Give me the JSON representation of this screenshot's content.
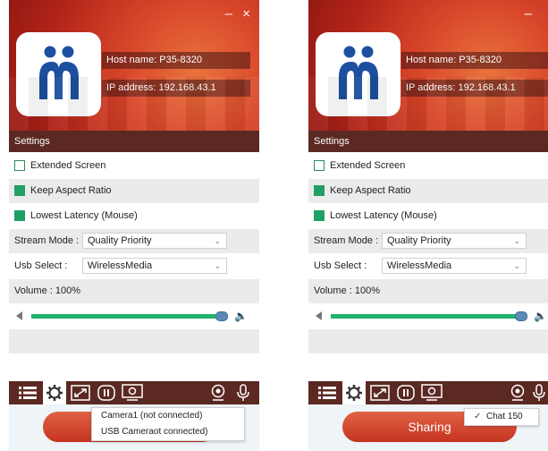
{
  "window": {
    "minimize_glyph": "–",
    "close_glyph": "×"
  },
  "panels": [
    {
      "host_name": "Host name: P35-8320",
      "ip_address": "IP address: 192.168.43.1",
      "settings_label": "Settings",
      "options": {
        "extended_screen": "Extended Screen",
        "extended_screen_checked": false,
        "keep_aspect": "Keep Aspect Ratio",
        "keep_aspect_checked": true,
        "lowest_latency": "Lowest Latency  (Mouse)",
        "lowest_latency_checked": true
      },
      "stream_mode": {
        "label": "Stream Mode :",
        "value": "Quality Priority"
      },
      "usb_select": {
        "label": "Usb Select :",
        "value": "WirelessMedia"
      },
      "volume": {
        "label": "Volume  : 100%",
        "level": 1.0
      },
      "popup": {
        "items": [
          "Camera1 (not connected)",
          "USB Cameraot connected)"
        ]
      }
    },
    {
      "host_name": "Host name: P35-8320",
      "ip_address": "IP address: 192.168.43.1",
      "settings_label": "Settings",
      "options": {
        "extended_screen": "Extended Screen",
        "extended_screen_checked": false,
        "keep_aspect": "Keep Aspect Ratio",
        "keep_aspect_checked": true,
        "lowest_latency": "Lowest Latency  (Mouse)",
        "lowest_latency_checked": true
      },
      "stream_mode": {
        "label": "Stream Mode :",
        "value": "Quality Priority"
      },
      "usb_select": {
        "label": "Usb Select :",
        "value": "WirelessMedia"
      },
      "volume": {
        "label": "Volume  : 100%",
        "level": 1.0
      },
      "share_button": "Sharing",
      "popup": {
        "check": "✓",
        "items": [
          "Chat 150"
        ]
      }
    }
  ],
  "toolbar_icons": [
    "list-icon",
    "gear-icon",
    "fullscreen-icon",
    "pause-icon",
    "camera-screen-icon",
    "webcam-icon",
    "microphone-icon"
  ],
  "colors": {
    "accent_green": "#1fa065",
    "header_red": "#c9341f",
    "dark_bar": "#5b2922",
    "share_button": "#d44a30",
    "logo_blue": "#1d4fa0"
  }
}
